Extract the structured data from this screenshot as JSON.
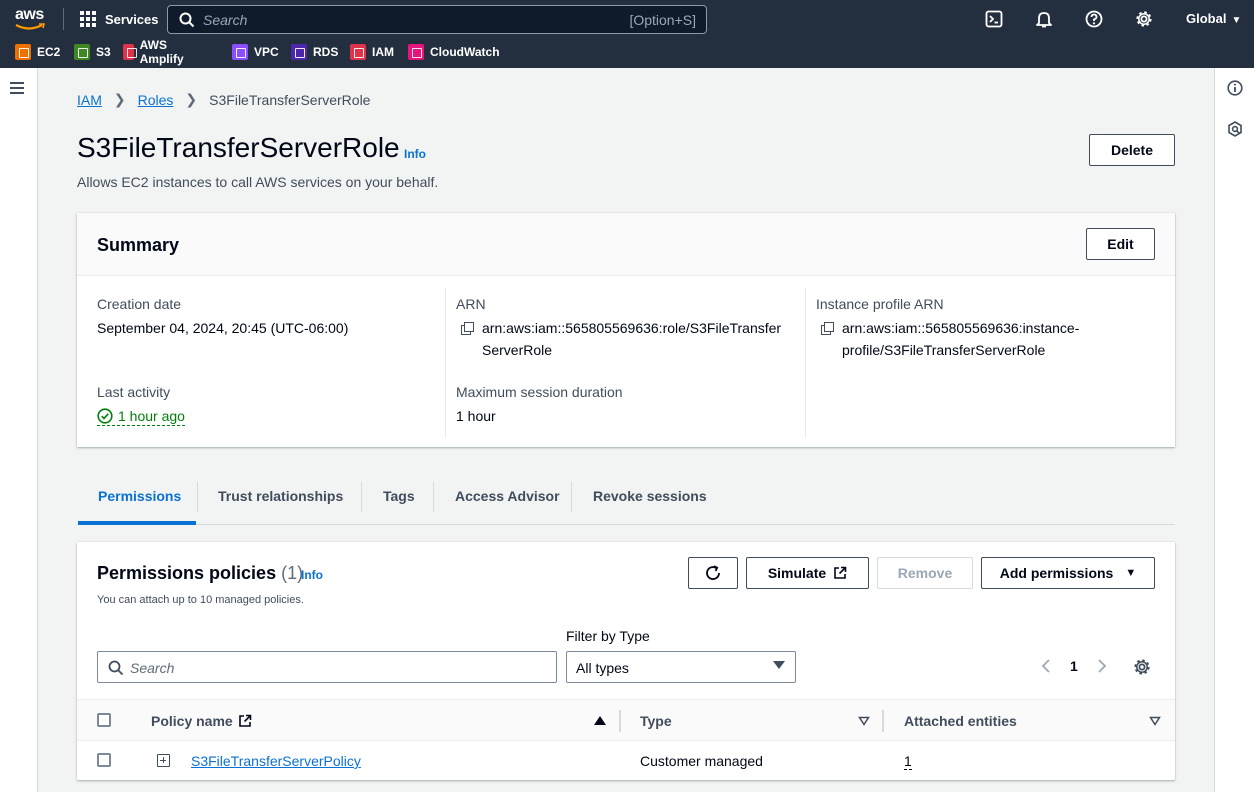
{
  "nav": {
    "logo": "aws",
    "services_label": "Services",
    "search_placeholder": "Search",
    "search_shortcut": "[Option+S]",
    "region": "Global",
    "favorites": [
      {
        "label": "EC2",
        "color": "#ed7100"
      },
      {
        "label": "S3",
        "color": "#3f8624"
      },
      {
        "label": "AWS Amplify",
        "color": "#dd344c"
      },
      {
        "label": "VPC",
        "color": "#8c4fff"
      },
      {
        "label": "RDS",
        "color": "#4d27aa"
      },
      {
        "label": "IAM",
        "color": "#dd344c"
      },
      {
        "label": "CloudWatch",
        "color": "#e7157b"
      }
    ],
    "icons": [
      "cloudshell-icon",
      "notifications-icon",
      "help-icon",
      "settings-icon"
    ]
  },
  "breadcrumb": {
    "items": [
      "IAM",
      "Roles"
    ],
    "current": "S3FileTransferServerRole"
  },
  "page": {
    "title": "S3FileTransferServerRole",
    "info": "Info",
    "description": "Allows EC2 instances to call AWS services on your behalf.",
    "delete_label": "Delete"
  },
  "summary": {
    "title": "Summary",
    "edit_label": "Edit",
    "creation_date_label": "Creation date",
    "creation_date": "September 04, 2024, 20:45 (UTC-06:00)",
    "last_activity_label": "Last activity",
    "last_activity": "1 hour ago",
    "arn_label": "ARN",
    "arn_line1": "arn:aws:iam::565805569636:role/S3FileTransfer",
    "arn_line2": "ServerRole",
    "max_session_label": "Maximum session duration",
    "max_session": "1 hour",
    "instance_profile_label": "Instance profile ARN",
    "instance_profile_line1": "arn:aws:iam::565805569636:instance-",
    "instance_profile_line2": "profile/S3FileTransferServerRole"
  },
  "tabs": [
    "Permissions",
    "Trust relationships",
    "Tags",
    "Access Advisor",
    "Revoke sessions"
  ],
  "permissions": {
    "title": "Permissions policies",
    "count": "(1)",
    "info": "Info",
    "description": "You can attach up to 10 managed policies.",
    "simulate_label": "Simulate",
    "remove_label": "Remove",
    "add_label": "Add permissions",
    "filter_label": "Filter by Type",
    "search_placeholder": "Search",
    "filter_value": "All types",
    "page": "1",
    "columns": [
      "Policy name",
      "Type",
      "Attached entities"
    ],
    "rows": [
      {
        "name": "S3FileTransferServerPolicy",
        "type": "Customer managed",
        "entities": "1"
      }
    ]
  }
}
